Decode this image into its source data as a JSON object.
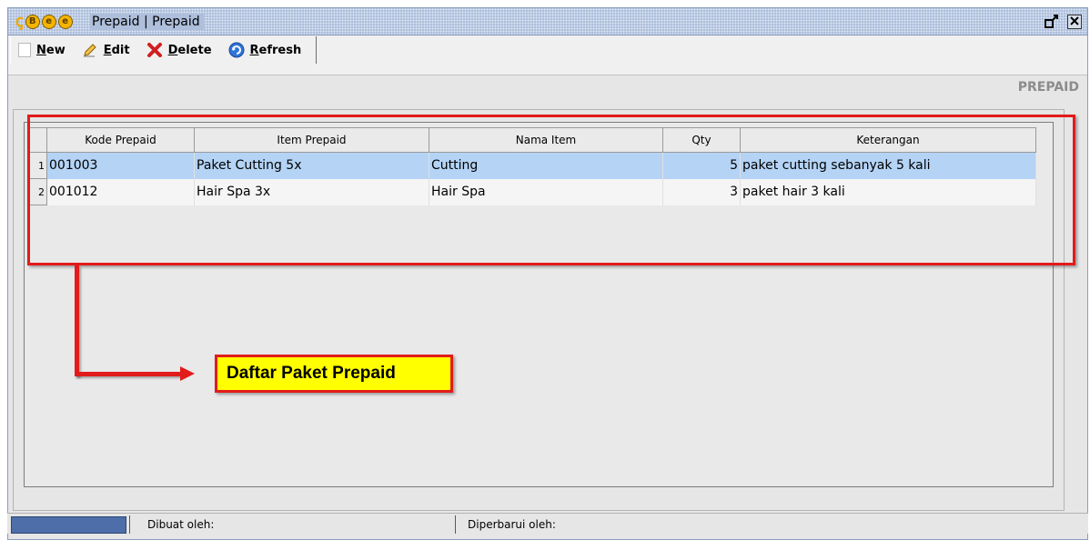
{
  "window": {
    "logo_text": "BEE",
    "title": "Prepaid | Prepaid",
    "restore_glyph": "ᵈ",
    "close_glyph": "✕"
  },
  "toolbar": {
    "new_label": "New",
    "edit_label": "Edit",
    "delete_label": "Delete",
    "refresh_label": "Refresh"
  },
  "panel": {
    "title": "PREPAID"
  },
  "grid": {
    "columns": [
      "Kode Prepaid",
      "Item Prepaid",
      "Nama Item",
      "Qty",
      "Keterangan"
    ],
    "rows": [
      {
        "no": "1",
        "kode": "001003",
        "item": "Paket Cutting 5x",
        "nama": "Cutting",
        "qty": "5",
        "ket": "paket cutting sebanyak 5 kali"
      },
      {
        "no": "2",
        "kode": "001012",
        "item": "Hair Spa 3x",
        "nama": "Hair Spa",
        "qty": "3",
        "ket": "paket hair 3 kali"
      }
    ]
  },
  "annotation": {
    "label": "Daftar Paket Prepaid"
  },
  "status": {
    "created_by": "Dibuat oleh:",
    "updated_by": "Diperbarui oleh:"
  },
  "colors": {
    "selected_row": "#b4d3f5",
    "annotation_red": "#e21b1b",
    "annotation_fill": "#ffff00"
  }
}
